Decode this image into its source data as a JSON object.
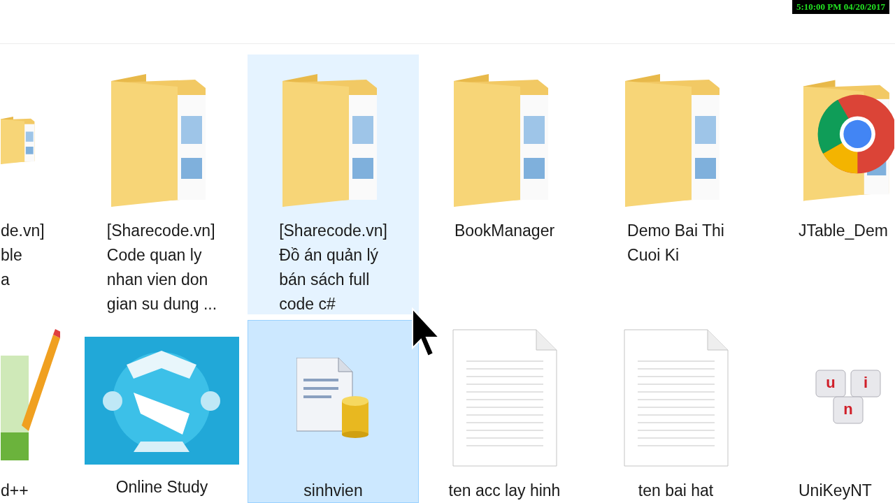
{
  "recording_timestamp": "5:10:00 PM 04/20/2017",
  "rows": [
    {
      "items": [
        {
          "kind": "folder",
          "label": [
            "de.vn]",
            "ble",
            "a"
          ],
          "hovered": false,
          "selected": false
        },
        {
          "kind": "folder",
          "label": [
            "[Sharecode.vn]",
            "Code quan ly",
            "nhan vien don",
            "gian su dung ..."
          ],
          "hovered": false,
          "selected": false
        },
        {
          "kind": "folder",
          "label": [
            "[Sharecode.vn]",
            "Đồ án quản lý",
            "bán sách full",
            "code c#"
          ],
          "hovered": true,
          "selected": false
        },
        {
          "kind": "folder",
          "label": [
            "BookManager"
          ],
          "hovered": false,
          "selected": false
        },
        {
          "kind": "folder",
          "label": [
            "Demo Bai Thi",
            "Cuoi Ki"
          ],
          "hovered": false,
          "selected": false
        },
        {
          "kind": "folder-logo",
          "label": [
            "JTable_Dem"
          ],
          "hovered": false,
          "selected": false
        }
      ]
    },
    {
      "items": [
        {
          "kind": "notepad",
          "label": [
            "d++"
          ],
          "hovered": false,
          "selected": false
        },
        {
          "kind": "picture",
          "label": [
            "Online Study"
          ],
          "hovered": false,
          "selected": false
        },
        {
          "kind": "database",
          "label": [
            "sinhvien"
          ],
          "hovered": false,
          "selected": true
        },
        {
          "kind": "text",
          "label": [
            "ten acc lay hinh"
          ],
          "hovered": false,
          "selected": false
        },
        {
          "kind": "text",
          "label": [
            "ten bai hat"
          ],
          "hovered": false,
          "selected": false
        },
        {
          "kind": "keyboard",
          "label": [
            "UniKeyNT"
          ],
          "key_letters": [
            "u",
            "i",
            "n"
          ],
          "hovered": false,
          "selected": false
        }
      ]
    }
  ]
}
